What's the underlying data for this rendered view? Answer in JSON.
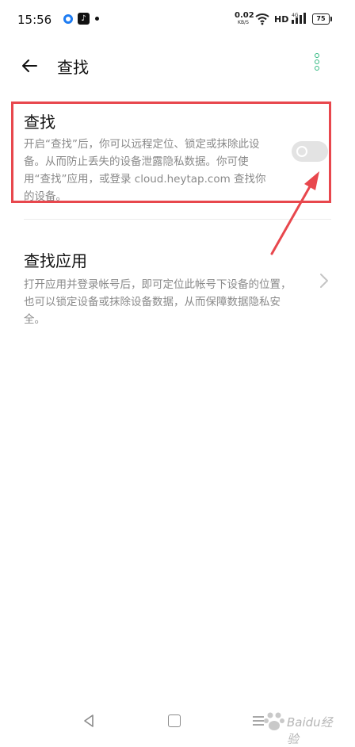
{
  "status_bar": {
    "time": "15:56",
    "tiktok_glyph": "♪",
    "net_speed": "0.02",
    "net_speed_unit": "KB/S",
    "hd_label": "HD",
    "battery": "75",
    "icons": [
      "blue-app-icon",
      "tiktok-icon",
      "notification-dot-icon",
      "wifi-icon",
      "signal-4g-icon",
      "battery-icon"
    ]
  },
  "header": {
    "title": "查找",
    "back_icon": "arrow-left-icon",
    "more_icon": "more-vertical-icon",
    "accent_color": "#30b880"
  },
  "find_section": {
    "title": "查找",
    "description": "开启“查找”后，你可以远程定位、锁定或抹除此设备。从而防止丢失的设备泄露隐私数据。你可使用“查找”应用，或登录 cloud.heytap.com 查找你的设备。",
    "toggle_on": false,
    "highlight_color": "#e8474d"
  },
  "app_section": {
    "title": "查找应用",
    "description": "打开应用并登录帐号后，即可定位此帐号下设备的位置，也可以锁定设备或抹除设备数据，从而保障数据隐私安全。",
    "chevron_icon": "chevron-right-icon"
  },
  "nav_bar": {
    "icons": [
      "nav-back-icon",
      "nav-home-icon",
      "nav-menu-icon"
    ]
  },
  "watermark": {
    "text": "Baidu经验"
  }
}
